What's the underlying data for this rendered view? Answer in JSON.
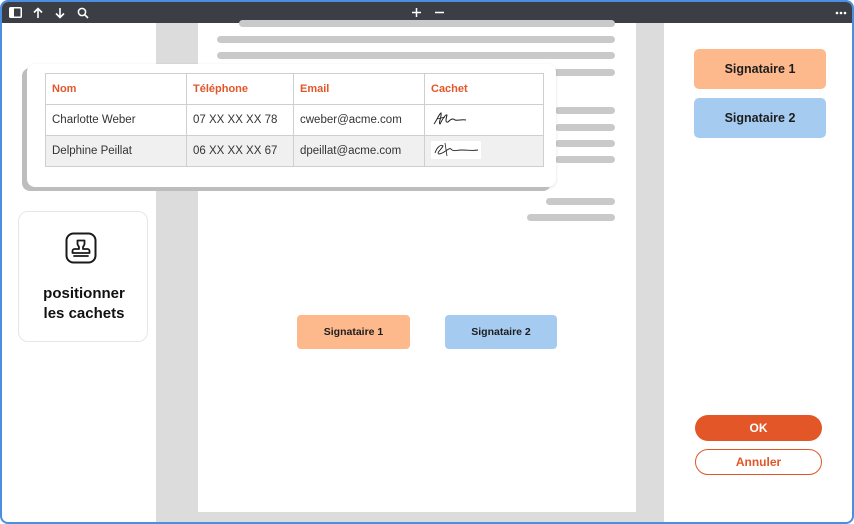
{
  "toolbar": {
    "icons": [
      "sidebar-toggle-icon",
      "arrow-up-icon",
      "arrow-down-icon",
      "search-icon",
      "zoom-in-icon",
      "zoom-out-icon",
      "more-options-icon"
    ]
  },
  "table": {
    "headers": {
      "name": "Nom",
      "phone": "Téléphone",
      "email": "Email",
      "stamp": "Cachet"
    },
    "rows": [
      {
        "name": "Charlotte Weber",
        "phone": "07 XX XX XX 78",
        "email": "cweber@acme.com"
      },
      {
        "name": "Delphine Peillat",
        "phone": "06 XX XX XX 67",
        "email": "dpeillat@acme.com"
      }
    ]
  },
  "stamp_card": {
    "label": "positionner\nles cachets",
    "icon": "stamp-icon"
  },
  "signers": {
    "signer1": "Signataire 1",
    "signer2": "Signataire 2"
  },
  "actions": {
    "ok": "OK",
    "cancel": "Annuler"
  },
  "colors": {
    "accent": "#e35627",
    "signer1": "#fdb88c",
    "signer2": "#a6cbf1",
    "toolbar": "#3b3f45",
    "frame": "#4a8fe0"
  }
}
